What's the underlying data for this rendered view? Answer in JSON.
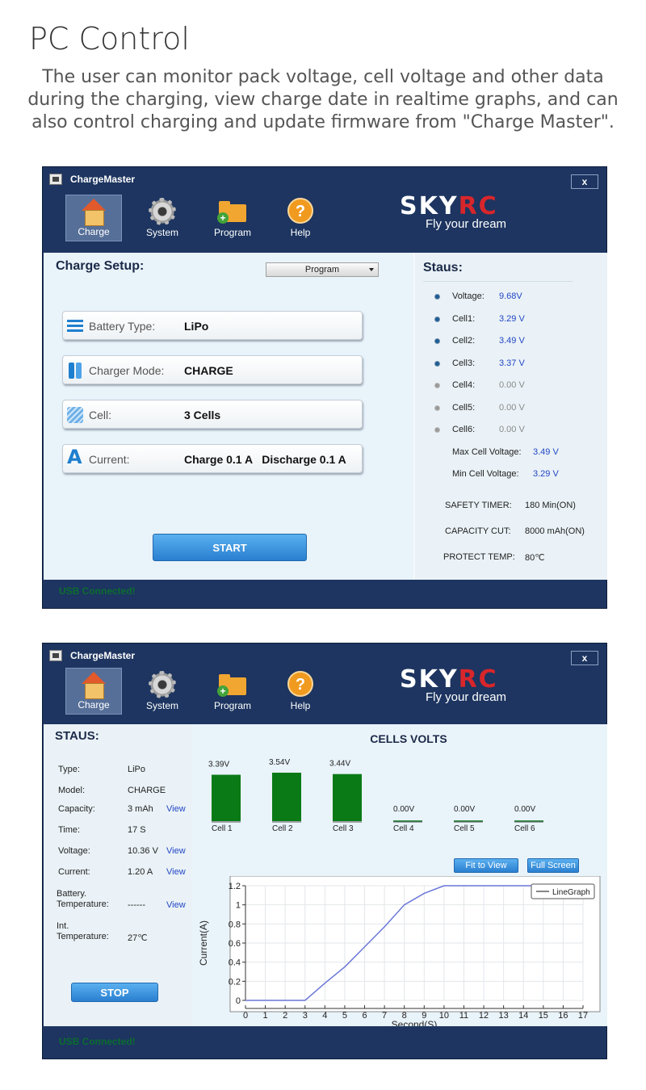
{
  "header": {
    "title": "PC Control",
    "description": "The user can monitor pack voltage, cell voltage and other data during the charging, view charge date in realtime graphs, and can also control charging and update firmware from \"Charge Master\"."
  },
  "app": {
    "title": "ChargeMaster",
    "close_label": "x",
    "toolbar": [
      {
        "label": "Charge",
        "icon": "house-icon"
      },
      {
        "label": "System",
        "icon": "gear-icon"
      },
      {
        "label": "Program",
        "icon": "folder-icon"
      },
      {
        "label": "Help",
        "icon": "help-icon"
      }
    ],
    "brand": {
      "name_a": "SKY",
      "name_b": "RC",
      "tagline": "Fly your dream"
    },
    "usb_status": "USB Connected!"
  },
  "setup": {
    "title": "Charge Setup:",
    "program_select": "Program",
    "rows": [
      {
        "label": "Battery Type:",
        "value": "LiPo"
      },
      {
        "label": "Charger Mode:",
        "value": "CHARGE"
      },
      {
        "label": "Cell:",
        "value": "3 Cells"
      },
      {
        "label": "Current:",
        "value": "Charge 0.1 A   Discharge 0.1 A"
      }
    ],
    "start_label": "START"
  },
  "status": {
    "title": "Staus:",
    "items": [
      {
        "label": "Voltage:",
        "value": "9.68V",
        "active": true
      },
      {
        "label": "Cell1:",
        "value": "3.29 V",
        "active": true
      },
      {
        "label": "Cell2:",
        "value": "3.49 V",
        "active": true
      },
      {
        "label": "Cell3:",
        "value": "3.37 V",
        "active": true
      },
      {
        "label": "Cell4:",
        "value": "0.00 V",
        "active": false
      },
      {
        "label": "Cell5:",
        "value": "0.00 V",
        "active": false
      },
      {
        "label": "Cell6:",
        "value": "0.00 V",
        "active": false
      }
    ],
    "max_cell_label": "Max Cell Voltage:",
    "max_cell_value": "3.49 V",
    "min_cell_label": "Min Cell Voltage:",
    "min_cell_value": "3.29 V",
    "safety_timer_label": "SAFETY TIMER:",
    "safety_timer_value": "180 Min(ON)",
    "capacity_cut_label": "CAPACITY CUT:",
    "capacity_cut_value": "8000 mAh(ON)",
    "protect_temp_label": "PROTECT TEMP:",
    "protect_temp_value": "80℃"
  },
  "monitor": {
    "title": "STAUS:",
    "rows": [
      {
        "label": "Type:",
        "value": "LiPo",
        "view": ""
      },
      {
        "label": "Model:",
        "value": "CHARGE",
        "view": ""
      },
      {
        "label": "Capacity:",
        "value": "3 mAh",
        "view": "View"
      },
      {
        "label": "Time:",
        "value": "17 S",
        "view": ""
      },
      {
        "label": "Voltage:",
        "value": "10.36 V",
        "view": "View"
      },
      {
        "label": "Current:",
        "value": "1.20 A",
        "view": "View"
      },
      {
        "label": "Battery. Temperature:",
        "value": "------",
        "view": "View"
      },
      {
        "label": "Int. Temperature:",
        "value": "27℃",
        "view": ""
      }
    ],
    "stop_label": "STOP",
    "cells_title": "CELLS VOLTS",
    "fit_label": "Fit to View",
    "full_label": "Full Screen"
  },
  "chart_data": [
    {
      "type": "bar",
      "title": "CELLS VOLTS",
      "categories": [
        "Cell 1",
        "Cell 2",
        "Cell 3",
        "Cell 4",
        "Cell 5",
        "Cell 6"
      ],
      "values": [
        3.39,
        3.54,
        3.44,
        0.0,
        0.0,
        0.0
      ],
      "value_labels": [
        "3.39V",
        "3.54V",
        "3.44V",
        "0.00V",
        "0.00V",
        "0.00V"
      ],
      "color": "#0a7a16"
    },
    {
      "type": "line",
      "xlabel": "Second(S)",
      "ylabel": "Current(A)",
      "legend": "LineGraph",
      "legend_position": "top-right",
      "grid": true,
      "xlim": [
        0,
        17
      ],
      "ylim": [
        0,
        1.2
      ],
      "xticks": [
        0,
        1,
        2,
        3,
        4,
        5,
        6,
        7,
        8,
        9,
        10,
        11,
        12,
        13,
        14,
        15,
        16,
        17
      ],
      "yticks": [
        0,
        0.2,
        0.4,
        0.6,
        0.8,
        1,
        1.2
      ],
      "ytick_labels": [
        "0",
        "0.2",
        "0.4",
        "0.6",
        "0.8",
        "1",
        "1.2"
      ],
      "color": "#6a77d8",
      "x": [
        0,
        1,
        2,
        3,
        4,
        5,
        6,
        7,
        8,
        9,
        10,
        11,
        12,
        13,
        14,
        15,
        16,
        17
      ],
      "y": [
        0,
        0,
        0,
        0,
        0.18,
        0.35,
        0.56,
        0.77,
        1.0,
        1.12,
        1.2,
        1.2,
        1.2,
        1.2,
        1.2,
        1.2,
        1.2,
        1.2
      ]
    }
  ]
}
